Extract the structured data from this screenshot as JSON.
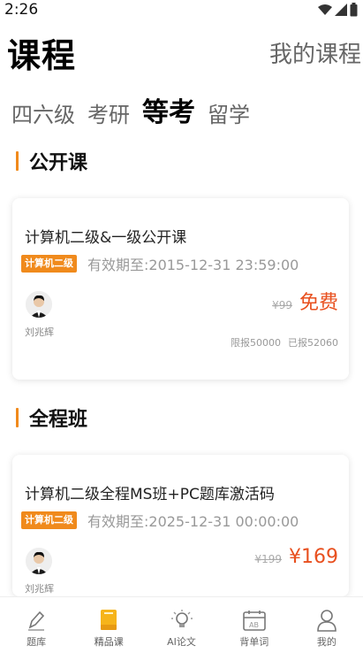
{
  "status_bar": {
    "time": "2:26"
  },
  "header": {
    "title": "课程",
    "my_courses": "我的课程"
  },
  "tabs": [
    {
      "label": "四六级"
    },
    {
      "label": "考研"
    },
    {
      "label": "等考",
      "active": true
    },
    {
      "label": "留学"
    }
  ],
  "sections": [
    {
      "title": "公开课",
      "course": {
        "title": "计算机二级&一级公开课",
        "tag": "计算机二级",
        "validity": "有效期至:2015-12-31 23:59:00",
        "teacher": "刘兆辉",
        "original_price": "¥99",
        "price": "免费",
        "limit": "限报50000",
        "enrolled": "已报52060"
      }
    },
    {
      "title": "全程班",
      "course": {
        "title": "计算机二级全程MS班+PC题库激活码",
        "tag": "计算机二级",
        "validity": "有效期至:2025-12-31 00:00:00",
        "teacher": "刘兆辉",
        "original_price": "¥199",
        "price": "¥169"
      }
    }
  ],
  "bottom_nav": [
    {
      "label": "题库",
      "icon": "pencil-icon"
    },
    {
      "label": "精品课",
      "icon": "book-icon",
      "active": true
    },
    {
      "label": "AI论文",
      "icon": "lightbulb-icon"
    },
    {
      "label": "背单词",
      "icon": "calendar-icon"
    },
    {
      "label": "我的",
      "icon": "person-icon"
    }
  ],
  "colors": {
    "accent": "#f08a1c",
    "price": "#e8501f"
  }
}
